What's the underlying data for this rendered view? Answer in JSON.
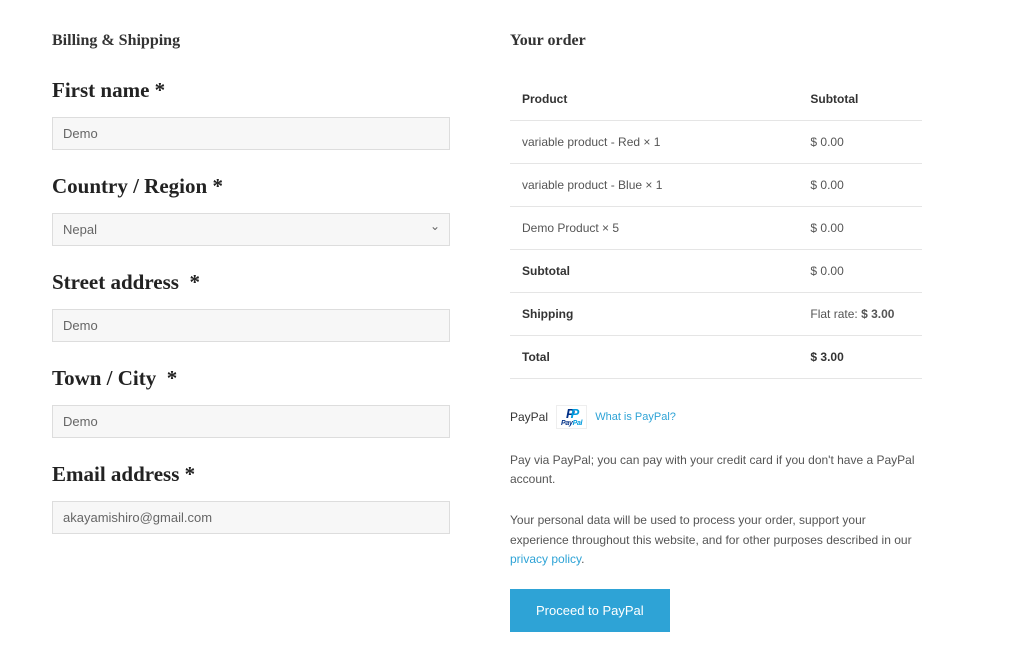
{
  "billing": {
    "heading": "Billing & Shipping",
    "first_name": {
      "label": "First name",
      "value": "Demo",
      "required": "*"
    },
    "country": {
      "label": "Country / Region",
      "value": "Nepal",
      "required": "*"
    },
    "street": {
      "label": "Street address",
      "value": "Demo",
      "required": "*"
    },
    "city": {
      "label": "Town / City",
      "value": "Demo",
      "required": "*"
    },
    "email": {
      "label": "Email address",
      "value": "akayamishiro@gmail.com",
      "required": "*"
    }
  },
  "order": {
    "heading": "Your order",
    "header_product": "Product",
    "header_subtotal": "Subtotal",
    "items": [
      {
        "name": "variable product - Red  × 1",
        "subtotal": "$ 0.00"
      },
      {
        "name": "variable product - Blue  × 1",
        "subtotal": "$ 0.00"
      },
      {
        "name": "Demo Product  × 5",
        "subtotal": "$ 0.00"
      }
    ],
    "subtotal_label": "Subtotal",
    "subtotal_value": "$ 0.00",
    "shipping_label": "Shipping",
    "shipping_prefix": "Flat rate: ",
    "shipping_value": "$ 3.00",
    "total_label": "Total",
    "total_value": "$ 3.00"
  },
  "payment": {
    "method_label": "PayPal",
    "what_is": "What is PayPal?",
    "description": "Pay via PayPal; you can pay with your credit card if you don't have a PayPal account.",
    "privacy_text_1": "Your personal data will be used to process your order, support your experience throughout this website, and for other purposes described in our ",
    "privacy_link": "privacy policy",
    "privacy_text_2": ".",
    "button": "Proceed to PayPal"
  }
}
